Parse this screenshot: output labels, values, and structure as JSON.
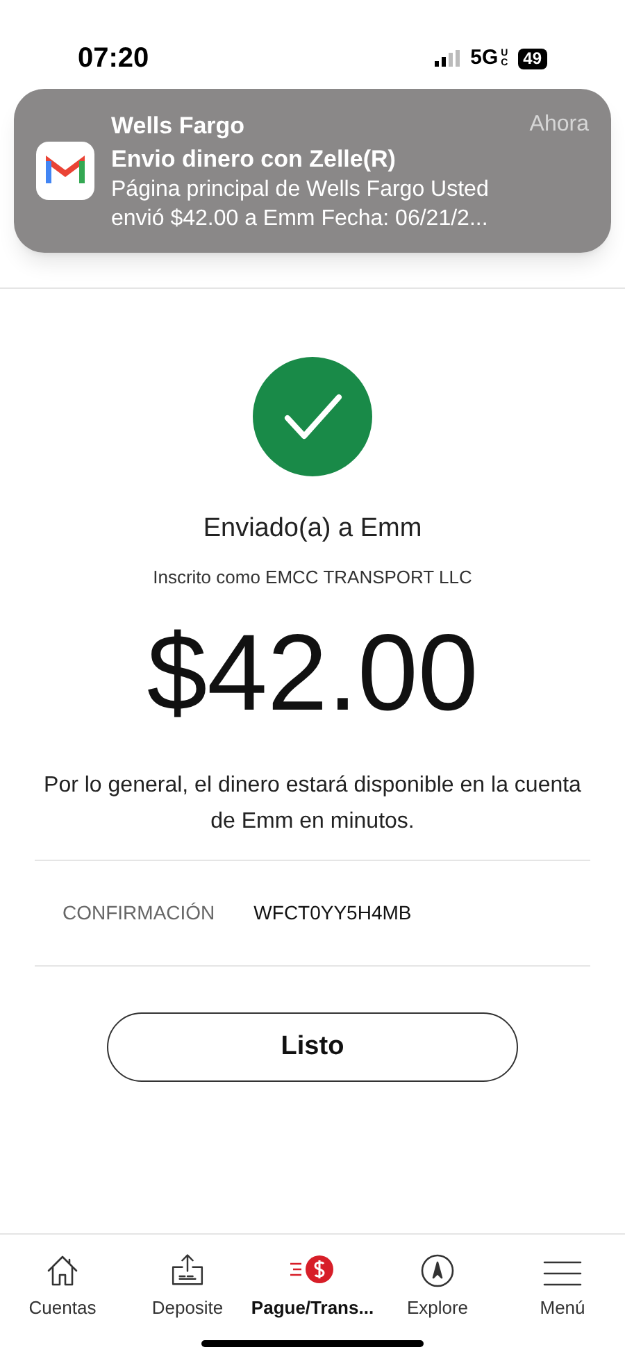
{
  "status_bar": {
    "time": "07:20",
    "network": "5G",
    "network_sub": "UC",
    "battery": "49"
  },
  "notification": {
    "app": "Wells Fargo",
    "time": "Ahora",
    "title": "Envio dinero con Zelle(R)",
    "body": "Página principal de Wells Fargo Usted envió $42.00 a Emm Fecha: 06/21/2..."
  },
  "confirmation": {
    "recipient": "Enviado(a) a Emm",
    "enrolled": "Inscrito como EMCC TRANSPORT LLC",
    "amount": "$42.00",
    "note": "Por lo general, el dinero estará disponible en la cuenta de Emm en minutos.",
    "label": "CONFIRMACIÓN",
    "code": "WFCT0YY5H4MB",
    "button": "Listo"
  },
  "tab_bar": [
    {
      "kind": "home",
      "label": "Cuentas",
      "selected": false
    },
    {
      "kind": "deposit",
      "label": "Deposite",
      "selected": false
    },
    {
      "kind": "pay",
      "label": "Pague/Trans...",
      "selected": true
    },
    {
      "kind": "explore",
      "label": "Explore",
      "selected": false
    },
    {
      "kind": "menu",
      "label": "Menú",
      "selected": false
    }
  ]
}
